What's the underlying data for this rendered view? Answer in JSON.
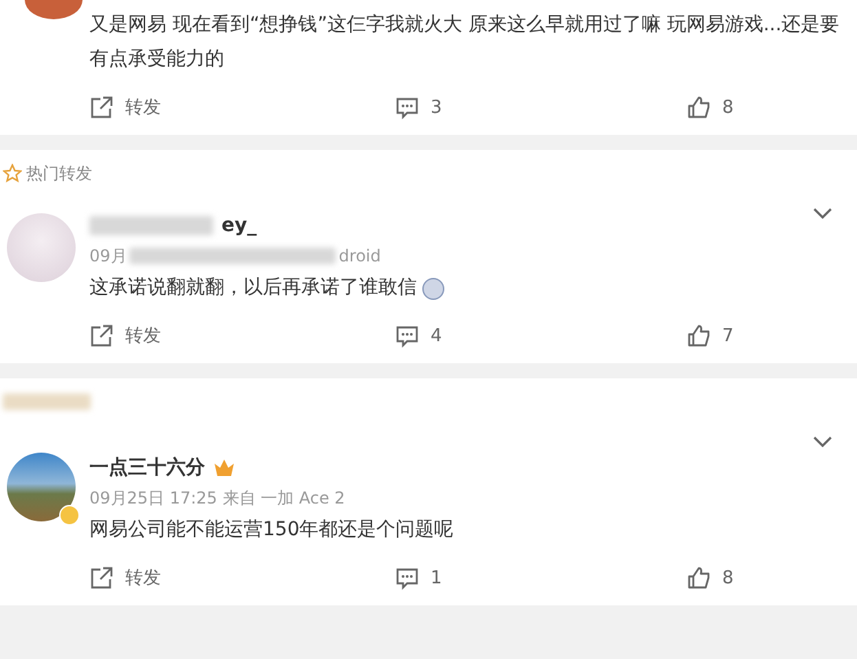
{
  "sections": [
    {
      "posts": [
        {
          "kind": "cut",
          "text": "又是网易 现在看到“想挣钱”这仨字我就火大 原来这么早就用过了嘛 玩网易游戏...还是要有点承受能力的",
          "repost": "转发",
          "comments": "3",
          "likes": "8"
        }
      ]
    },
    {
      "label": {
        "kind": "text",
        "text": "热门转发"
      },
      "posts": [
        {
          "kind": "blurred",
          "name": "ey_",
          "meta_start": "09月",
          "meta_end": "droid",
          "text": "这承诺说翻就翻，以后再承诺了谁敢信",
          "emoji": true,
          "repost": "转发",
          "comments": "4",
          "likes": "7"
        }
      ]
    },
    {
      "label": {
        "kind": "blurred"
      },
      "posts": [
        {
          "kind": "full",
          "name": "一点三十六分",
          "meta": "09月25日 17:25 来自 一加 Ace 2",
          "verified": true,
          "text": "网易公司能不能运营150年都还是个问题呢",
          "repost": "转发",
          "comments": "1",
          "likes": "8"
        }
      ]
    }
  ]
}
